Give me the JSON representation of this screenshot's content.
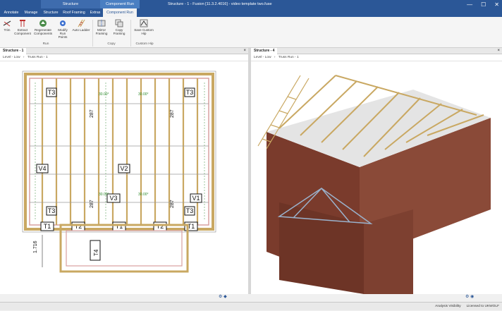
{
  "window": {
    "context_group": "Structure",
    "context_tab": "Component Run",
    "title": "Structure - 1 - Fusion [11.3.2.4016] - video template two.fuse",
    "min": "—",
    "max": "☐",
    "close": "✕"
  },
  "tabs": [
    "Annotate",
    "Manage",
    "Structure",
    "Roof Framing",
    "Extras",
    "Component Run"
  ],
  "ribbon": {
    "buttons": [
      {
        "label": "Trim"
      },
      {
        "label": "Extract Component"
      },
      {
        "label": "Regenerate Components"
      },
      {
        "label": "Modify Run Points"
      },
      {
        "label": "Auto Ladder"
      },
      {
        "label": "Mirror Framing"
      },
      {
        "label": "Copy Framing"
      },
      {
        "label": "Save Custom Hip"
      }
    ],
    "groups": [
      "Run",
      "Copy",
      "Custom Hip"
    ]
  },
  "panes": {
    "left": {
      "tab": "Structure - 1",
      "crumb_level": "Level - Low",
      "crumb_run": "Truss Run - 1"
    },
    "right": {
      "tab": "Structure - 4",
      "crumb_level": "Level - Low",
      "crumb_run": "Truss Run - 1"
    }
  },
  "plan": {
    "labels": [
      "T3",
      "V4",
      "V2",
      "T3",
      "T1",
      "T2",
      "T1",
      "T2",
      "T1",
      "T3",
      "V3",
      "V1",
      "T3",
      "T4"
    ],
    "dims": [
      "287",
      "287",
      "287",
      "287",
      "1.716"
    ],
    "angles": [
      "30.00°",
      "30.00°",
      "30.00°",
      "30.00°"
    ]
  },
  "status": {
    "analysis": "Analysis Visibility",
    "license": "Licensed to UKWOLF"
  },
  "colors": {
    "accent": "#2b5797",
    "timber": "#c9a862",
    "brick": "#7a3b2c",
    "roof_green": "#5aa05a"
  }
}
